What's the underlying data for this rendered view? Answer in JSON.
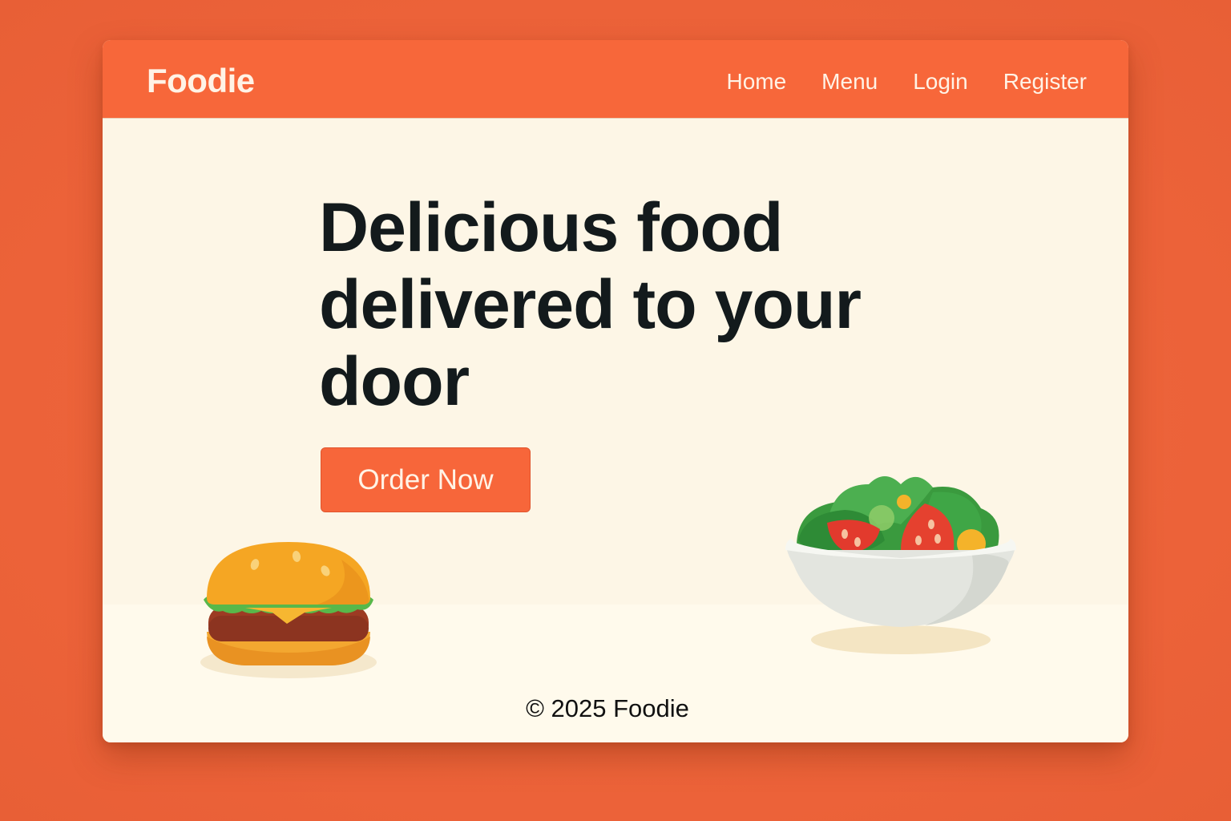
{
  "brand": {
    "name": "Foodie"
  },
  "nav": {
    "items": [
      {
        "label": "Home"
      },
      {
        "label": "Menu"
      },
      {
        "label": "Login"
      },
      {
        "label": "Register"
      }
    ]
  },
  "hero": {
    "headline": "Delicious food delivered to your door",
    "cta_label": "Order Now"
  },
  "footer": {
    "text": "© 2025 Foodie"
  },
  "colors": {
    "page_background": "#ee643a",
    "brand_orange": "#f7673a",
    "hero_background": "#fdf6e6",
    "headline_text": "#131a1c",
    "nav_text": "#fff3e6"
  },
  "illustrations": [
    {
      "icon": "burger-icon"
    },
    {
      "icon": "salad-bowl-icon"
    }
  ]
}
